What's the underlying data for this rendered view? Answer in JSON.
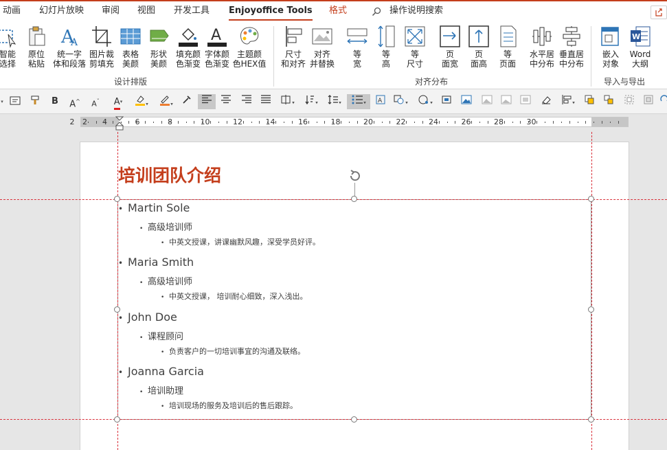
{
  "tabs": [
    {
      "label": "动画"
    },
    {
      "label": "幻灯片放映"
    },
    {
      "label": "审阅"
    },
    {
      "label": "视图"
    },
    {
      "label": "开发工具"
    },
    {
      "label": "Enjoyoffice Tools"
    },
    {
      "label": "格式"
    }
  ],
  "search": {
    "label": "操作说明搜索",
    "icon": "search-icon"
  },
  "ribbon": {
    "group1": {
      "label": "设计排版",
      "buttons": [
        {
          "line1": "智能",
          "line2": "选择",
          "icon": "smart-select-icon"
        },
        {
          "line1": "原位",
          "line2": "粘贴",
          "icon": "paste-in-place-icon"
        },
        {
          "line1": "统一字",
          "line2": "体和段落",
          "icon": "unify-font-icon"
        },
        {
          "line1": "图片裁",
          "line2": "剪填充",
          "icon": "crop-fill-icon"
        },
        {
          "line1": "表格",
          "line2": "美颜",
          "icon": "table-beautify-icon"
        },
        {
          "line1": "形状",
          "line2": "美颜",
          "icon": "shape-beautify-icon"
        },
        {
          "line1": "填充颜",
          "line2": "色渐变",
          "icon": "fill-gradient-icon"
        },
        {
          "line1": "字体颜",
          "line2": "色渐变",
          "icon": "font-gradient-icon"
        },
        {
          "line1": "主题颜",
          "line2": "色HEX值",
          "icon": "theme-color-icon"
        }
      ]
    },
    "group2": {
      "label": "对齐分布",
      "buttons": [
        {
          "line1": "尺寸",
          "line2": "和对齐",
          "icon": "size-align-icon"
        },
        {
          "line1": "对齐",
          "line2": "并替换",
          "icon": "align-replace-icon"
        },
        {
          "line1": "等",
          "line2": "宽",
          "icon": "equal-width-icon"
        },
        {
          "line1": "等",
          "line2": "高",
          "icon": "equal-height-icon"
        },
        {
          "line1": "等",
          "line2": "尺寸",
          "icon": "equal-size-icon"
        },
        {
          "line1": "页",
          "line2": "面宽",
          "icon": "page-width-icon"
        },
        {
          "line1": "页",
          "line2": "面高",
          "icon": "page-height-icon"
        },
        {
          "line1": "等",
          "line2": "页面",
          "icon": "page-size-icon"
        },
        {
          "line1": "水平居",
          "line2": "中分布",
          "icon": "h-distribute-icon"
        },
        {
          "line1": "垂直居",
          "line2": "中分布",
          "icon": "v-distribute-icon"
        }
      ]
    },
    "group3": {
      "label": "导入与导出",
      "buttons": [
        {
          "line1": "嵌入",
          "line2": "对象",
          "icon": "embed-object-icon"
        },
        {
          "line1": "Word",
          "line2": "大纲",
          "icon": "word-outline-icon"
        }
      ]
    }
  },
  "format_toolbar": {
    "bold": "B",
    "grow": "A",
    "shrink": "A"
  },
  "ruler": {
    "numbers": [
      "2",
      "2",
      "4",
      "6",
      "8",
      "10",
      "12",
      "14",
      "16",
      "18",
      "20",
      "22",
      "24",
      "26",
      "28",
      "30"
    ]
  },
  "slide": {
    "title": "培训团队介绍",
    "members": [
      {
        "name": "Martin Sole",
        "role": "高级培训师",
        "detail": "中英文授课，讲课幽默风趣，深受学员好评。"
      },
      {
        "name": "Maria Smith",
        "role": "高级培训师",
        "detail": "中英文授课， 培训耐心细致，深入浅出。"
      },
      {
        "name": "John Doe",
        "role": "课程顾问",
        "detail": "负责客户的一切培训事宜的沟通及联络。"
      },
      {
        "name": "Joanna Garcia",
        "role": "培训助理",
        "detail": "培训现场的服务及培训后的售后跟踪。"
      }
    ]
  },
  "colors": {
    "accent": "#c43e1c",
    "guide": "#d9303a"
  }
}
